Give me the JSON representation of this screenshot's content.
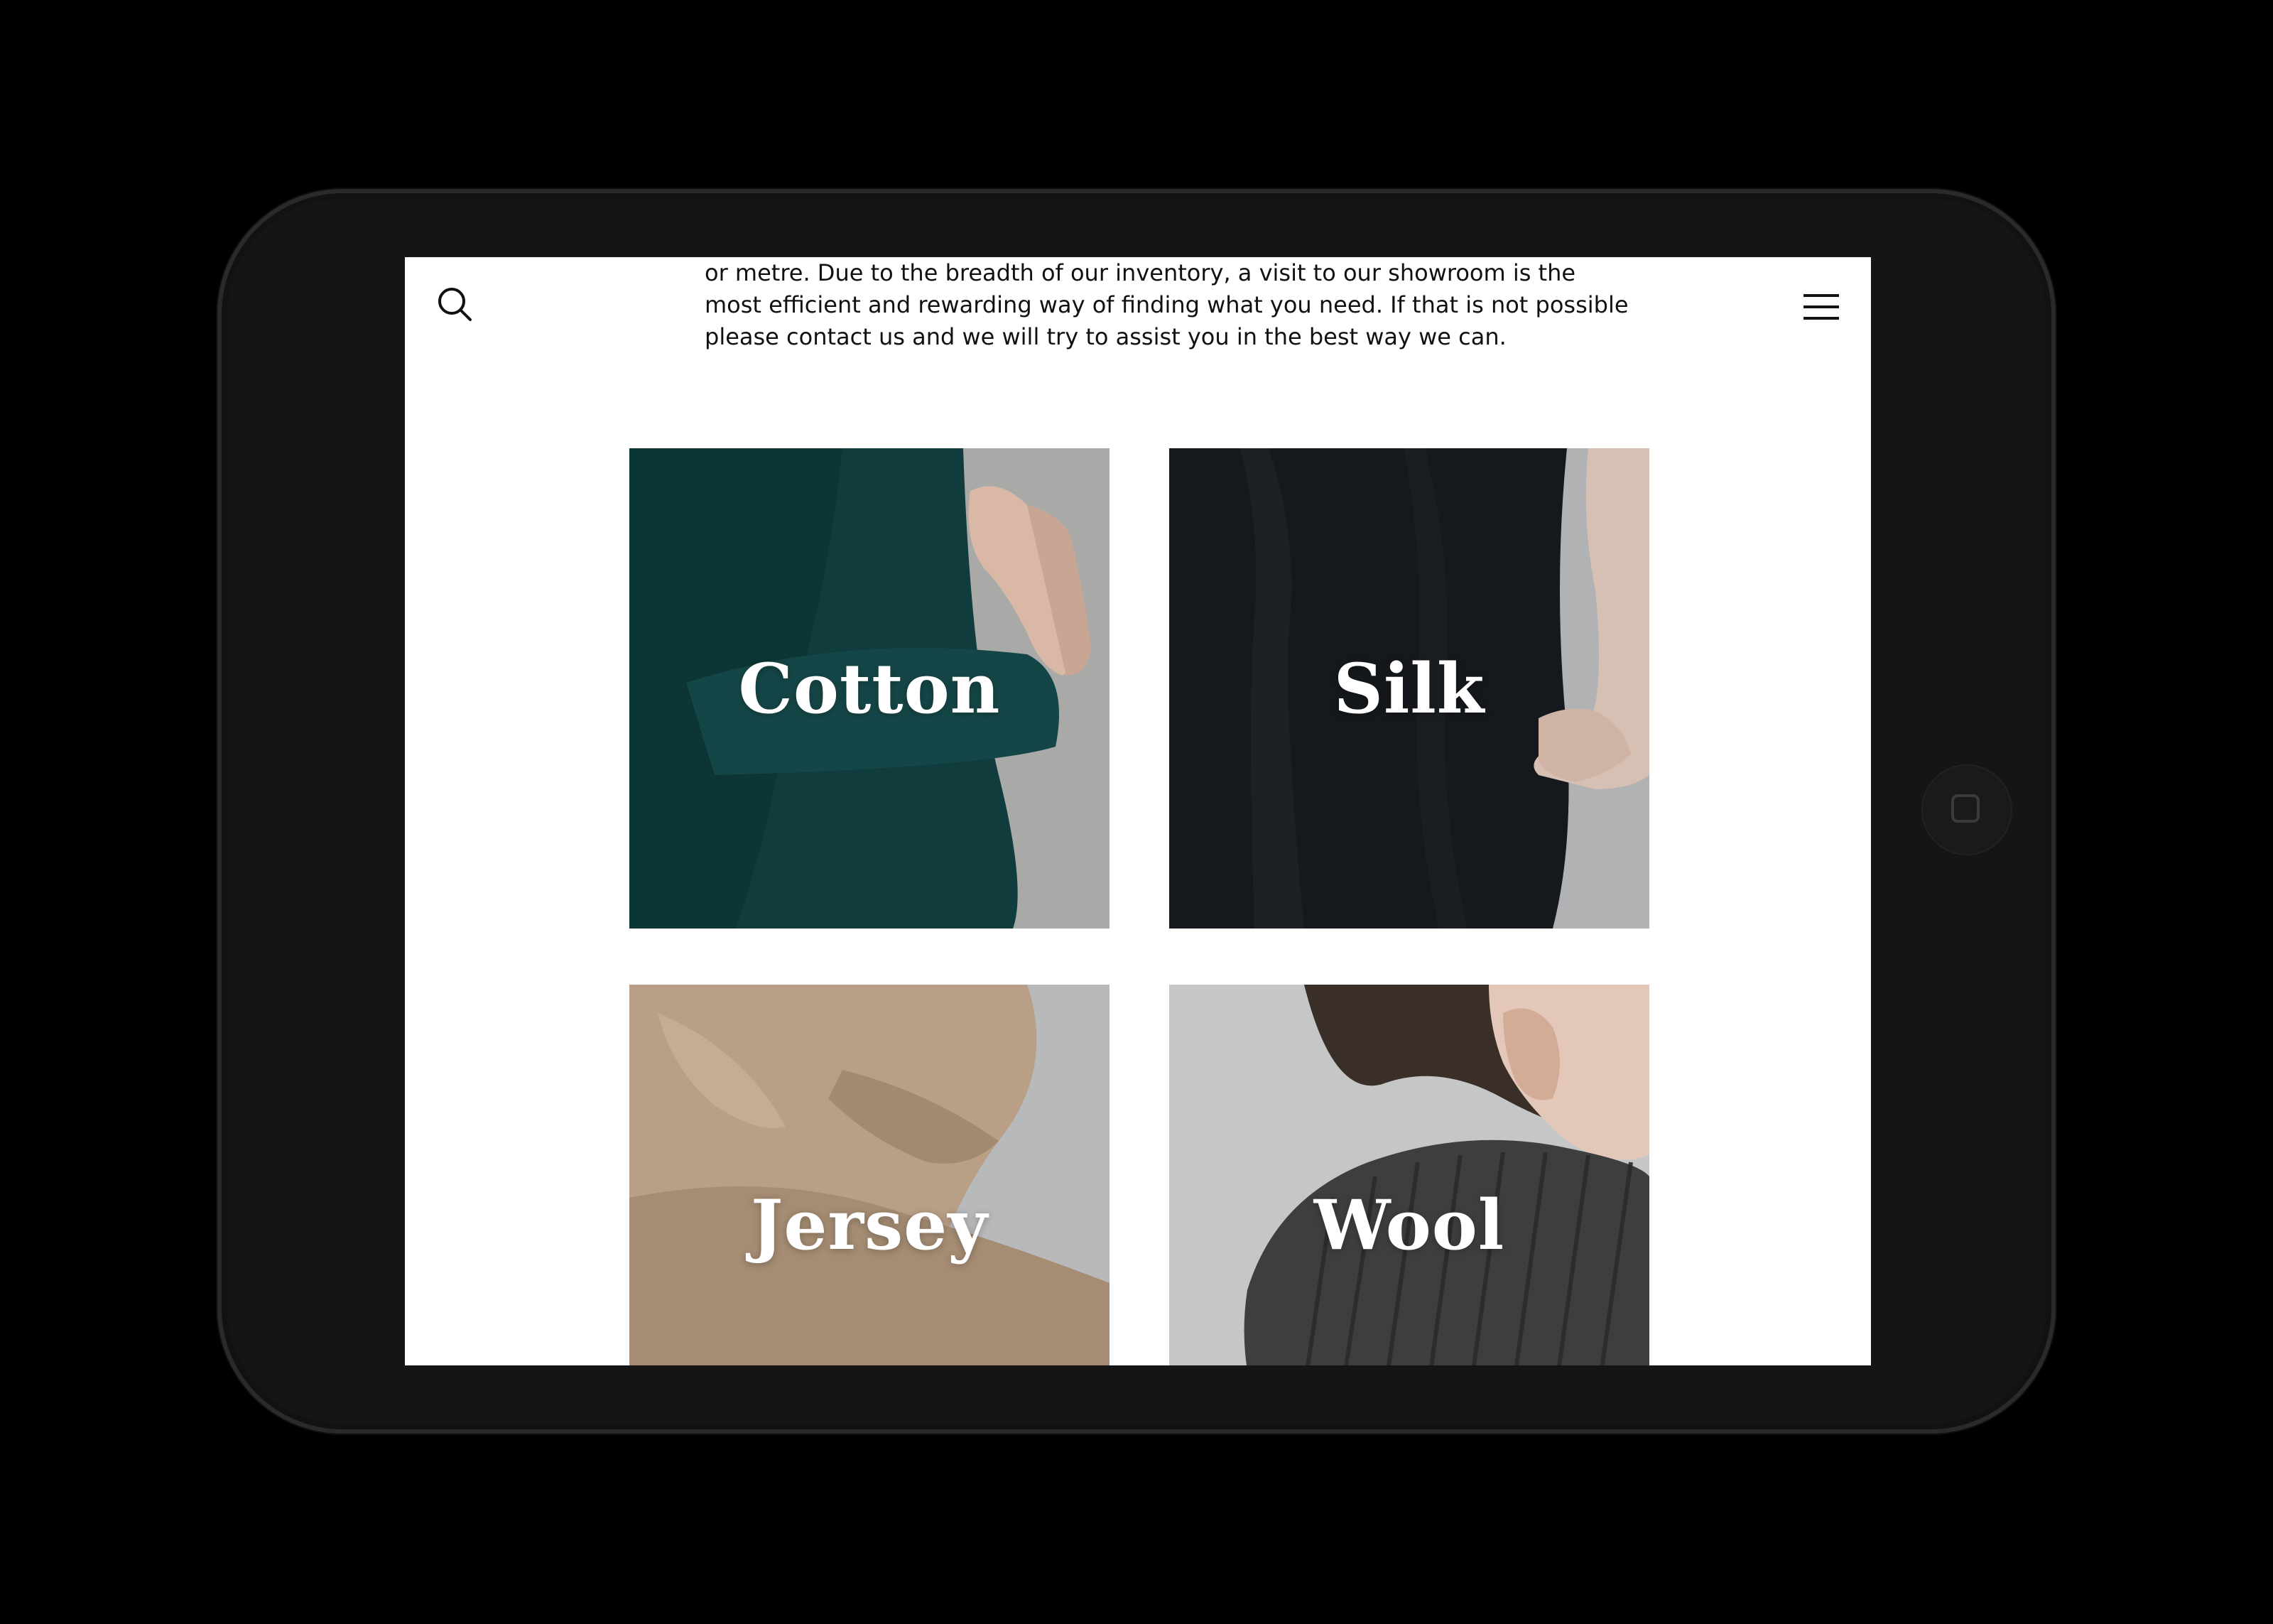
{
  "device": {
    "type": "tablet",
    "orientation": "landscape"
  },
  "header": {
    "search_icon": "search-icon",
    "menu_icon": "hamburger-menu-icon"
  },
  "intro": {
    "lines": [
      "or metre. Due to the breadth of our inventory, a visit to our showroom is the",
      "most efficient and rewarding way of finding what you need. If that is not possible",
      "please contact us and we will try to assist you in the best way we can."
    ]
  },
  "categories": [
    {
      "label": "Cotton",
      "color": "#0f3a3a"
    },
    {
      "label": "Silk",
      "color": "#15181c"
    },
    {
      "label": "Jersey",
      "color": "#b79e84"
    },
    {
      "label": "Wool",
      "color": "#3a3c3c"
    }
  ]
}
